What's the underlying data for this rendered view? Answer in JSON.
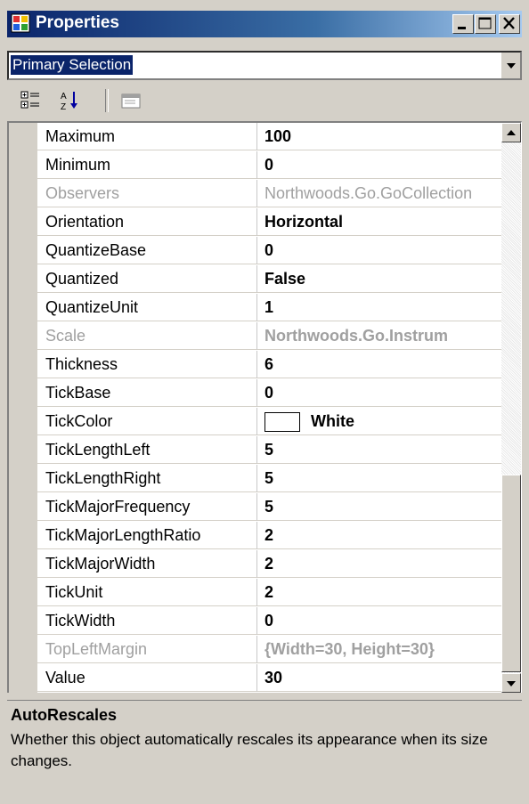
{
  "window": {
    "title": "Properties",
    "icon": "properties-window-icon"
  },
  "caption_buttons": {
    "minimize": "minimize-icon",
    "maximize": "maximize-icon",
    "close": "close-icon"
  },
  "selector": {
    "value": "Primary Selection"
  },
  "toolbar": {
    "buttons": [
      "categorized-icon",
      "alphabetical-icon",
      "property-pages-icon"
    ]
  },
  "properties": [
    {
      "name": "Maximum",
      "value": "100",
      "bold": true,
      "disabled": false
    },
    {
      "name": "Minimum",
      "value": "0",
      "bold": true,
      "disabled": false
    },
    {
      "name": "Observers",
      "value": "Northwoods.Go.GoCollection",
      "bold": false,
      "disabled": true
    },
    {
      "name": "Orientation",
      "value": "Horizontal",
      "bold": true,
      "disabled": false
    },
    {
      "name": "QuantizeBase",
      "value": "0",
      "bold": true,
      "disabled": false
    },
    {
      "name": "Quantized",
      "value": "False",
      "bold": true,
      "disabled": false
    },
    {
      "name": "QuantizeUnit",
      "value": "1",
      "bold": true,
      "disabled": false
    },
    {
      "name": "Scale",
      "value": "Northwoods.Go.Instrum",
      "bold": true,
      "disabled": true
    },
    {
      "name": "Thickness",
      "value": "6",
      "bold": true,
      "disabled": false
    },
    {
      "name": "TickBase",
      "value": "0",
      "bold": true,
      "disabled": false
    },
    {
      "name": "TickColor",
      "value": "White",
      "bold": true,
      "disabled": false,
      "swatch": "#ffffff"
    },
    {
      "name": "TickLengthLeft",
      "value": "5",
      "bold": true,
      "disabled": false
    },
    {
      "name": "TickLengthRight",
      "value": "5",
      "bold": true,
      "disabled": false
    },
    {
      "name": "TickMajorFrequency",
      "value": "5",
      "bold": true,
      "disabled": false
    },
    {
      "name": "TickMajorLengthRatio",
      "value": "2",
      "bold": true,
      "disabled": false
    },
    {
      "name": "TickMajorWidth",
      "value": "2",
      "bold": true,
      "disabled": false
    },
    {
      "name": "TickUnit",
      "value": "2",
      "bold": true,
      "disabled": false
    },
    {
      "name": "TickWidth",
      "value": "0",
      "bold": true,
      "disabled": false
    },
    {
      "name": "TopLeftMargin",
      "value": "{Width=30, Height=30}",
      "bold": true,
      "disabled": true
    },
    {
      "name": "Value",
      "value": "30",
      "bold": true,
      "disabled": false
    }
  ],
  "description": {
    "title": "AutoRescales",
    "text": "Whether this object automatically rescales its appearance when its size changes."
  },
  "colors": {
    "titlebar_start": "#0a246a",
    "titlebar_end": "#a6caf0",
    "face": "#d4d0c8",
    "selection": "#0a246a"
  }
}
